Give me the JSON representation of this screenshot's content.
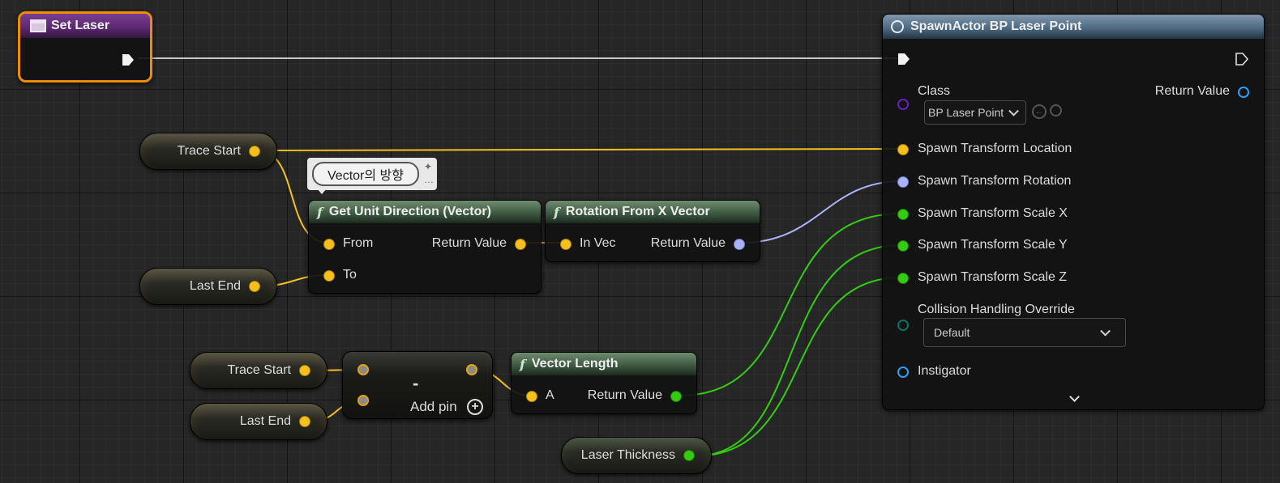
{
  "colors": {
    "exec_wire": "#c8c8c8",
    "vector_wire": "#f6c01c",
    "rotator_wire": "#a9b3f7",
    "float_wire": "#33cc11",
    "selected_outline": "#f08c00"
  },
  "set_laser": {
    "title": "Set Laser"
  },
  "comment": {
    "text": "Vector의 방향"
  },
  "get_unit_direction": {
    "title": "Get Unit Direction (Vector)",
    "from_label": "From",
    "to_label": "To",
    "return_label": "Return Value"
  },
  "rotation_from_x": {
    "title": "Rotation From X Vector",
    "in_label": "In Vec",
    "return_label": "Return Value"
  },
  "vector_length": {
    "title": "Vector Length",
    "a_label": "A",
    "return_label": "Return Value"
  },
  "subtract": {
    "symbol": "-",
    "add_pin_label": "Add pin"
  },
  "variables": {
    "trace_start_1": "Trace Start",
    "last_end_1": "Last End",
    "trace_start_2": "Trace Start",
    "last_end_2": "Last End",
    "laser_thickness": "Laser Thickness"
  },
  "spawn_actor": {
    "title": "SpawnActor BP Laser Point",
    "class_label": "Class",
    "class_value": "BP Laser Point",
    "return_label": "Return Value",
    "pins": [
      "Spawn Transform Location",
      "Spawn Transform Rotation",
      "Spawn Transform Scale X",
      "Spawn Transform Scale Y",
      "Spawn Transform Scale Z"
    ],
    "collision_label": "Collision Handling Override",
    "collision_value": "Default",
    "instigator_label": "Instigator"
  },
  "icons": {
    "function": "function-icon",
    "spawn": "spawn-actor-icon",
    "set": "set-variable-icon"
  }
}
